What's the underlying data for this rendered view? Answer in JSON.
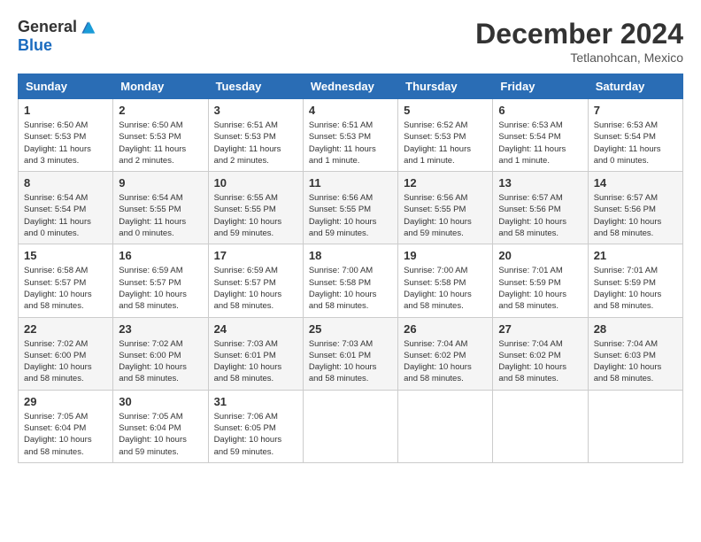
{
  "header": {
    "logo_general": "General",
    "logo_blue": "Blue",
    "title": "December 2024",
    "location": "Tetlanohcan, Mexico"
  },
  "weekdays": [
    "Sunday",
    "Monday",
    "Tuesday",
    "Wednesday",
    "Thursday",
    "Friday",
    "Saturday"
  ],
  "weeks": [
    [
      {
        "day": "1",
        "info": "Sunrise: 6:50 AM\nSunset: 5:53 PM\nDaylight: 11 hours\nand 3 minutes."
      },
      {
        "day": "2",
        "info": "Sunrise: 6:50 AM\nSunset: 5:53 PM\nDaylight: 11 hours\nand 2 minutes."
      },
      {
        "day": "3",
        "info": "Sunrise: 6:51 AM\nSunset: 5:53 PM\nDaylight: 11 hours\nand 2 minutes."
      },
      {
        "day": "4",
        "info": "Sunrise: 6:51 AM\nSunset: 5:53 PM\nDaylight: 11 hours\nand 1 minute."
      },
      {
        "day": "5",
        "info": "Sunrise: 6:52 AM\nSunset: 5:53 PM\nDaylight: 11 hours\nand 1 minute."
      },
      {
        "day": "6",
        "info": "Sunrise: 6:53 AM\nSunset: 5:54 PM\nDaylight: 11 hours\nand 1 minute."
      },
      {
        "day": "7",
        "info": "Sunrise: 6:53 AM\nSunset: 5:54 PM\nDaylight: 11 hours\nand 0 minutes."
      }
    ],
    [
      {
        "day": "8",
        "info": "Sunrise: 6:54 AM\nSunset: 5:54 PM\nDaylight: 11 hours\nand 0 minutes."
      },
      {
        "day": "9",
        "info": "Sunrise: 6:54 AM\nSunset: 5:55 PM\nDaylight: 11 hours\nand 0 minutes."
      },
      {
        "day": "10",
        "info": "Sunrise: 6:55 AM\nSunset: 5:55 PM\nDaylight: 10 hours\nand 59 minutes."
      },
      {
        "day": "11",
        "info": "Sunrise: 6:56 AM\nSunset: 5:55 PM\nDaylight: 10 hours\nand 59 minutes."
      },
      {
        "day": "12",
        "info": "Sunrise: 6:56 AM\nSunset: 5:55 PM\nDaylight: 10 hours\nand 59 minutes."
      },
      {
        "day": "13",
        "info": "Sunrise: 6:57 AM\nSunset: 5:56 PM\nDaylight: 10 hours\nand 58 minutes."
      },
      {
        "day": "14",
        "info": "Sunrise: 6:57 AM\nSunset: 5:56 PM\nDaylight: 10 hours\nand 58 minutes."
      }
    ],
    [
      {
        "day": "15",
        "info": "Sunrise: 6:58 AM\nSunset: 5:57 PM\nDaylight: 10 hours\nand 58 minutes."
      },
      {
        "day": "16",
        "info": "Sunrise: 6:59 AM\nSunset: 5:57 PM\nDaylight: 10 hours\nand 58 minutes."
      },
      {
        "day": "17",
        "info": "Sunrise: 6:59 AM\nSunset: 5:57 PM\nDaylight: 10 hours\nand 58 minutes."
      },
      {
        "day": "18",
        "info": "Sunrise: 7:00 AM\nSunset: 5:58 PM\nDaylight: 10 hours\nand 58 minutes."
      },
      {
        "day": "19",
        "info": "Sunrise: 7:00 AM\nSunset: 5:58 PM\nDaylight: 10 hours\nand 58 minutes."
      },
      {
        "day": "20",
        "info": "Sunrise: 7:01 AM\nSunset: 5:59 PM\nDaylight: 10 hours\nand 58 minutes."
      },
      {
        "day": "21",
        "info": "Sunrise: 7:01 AM\nSunset: 5:59 PM\nDaylight: 10 hours\nand 58 minutes."
      }
    ],
    [
      {
        "day": "22",
        "info": "Sunrise: 7:02 AM\nSunset: 6:00 PM\nDaylight: 10 hours\nand 58 minutes."
      },
      {
        "day": "23",
        "info": "Sunrise: 7:02 AM\nSunset: 6:00 PM\nDaylight: 10 hours\nand 58 minutes."
      },
      {
        "day": "24",
        "info": "Sunrise: 7:03 AM\nSunset: 6:01 PM\nDaylight: 10 hours\nand 58 minutes."
      },
      {
        "day": "25",
        "info": "Sunrise: 7:03 AM\nSunset: 6:01 PM\nDaylight: 10 hours\nand 58 minutes."
      },
      {
        "day": "26",
        "info": "Sunrise: 7:04 AM\nSunset: 6:02 PM\nDaylight: 10 hours\nand 58 minutes."
      },
      {
        "day": "27",
        "info": "Sunrise: 7:04 AM\nSunset: 6:02 PM\nDaylight: 10 hours\nand 58 minutes."
      },
      {
        "day": "28",
        "info": "Sunrise: 7:04 AM\nSunset: 6:03 PM\nDaylight: 10 hours\nand 58 minutes."
      }
    ],
    [
      {
        "day": "29",
        "info": "Sunrise: 7:05 AM\nSunset: 6:04 PM\nDaylight: 10 hours\nand 58 minutes."
      },
      {
        "day": "30",
        "info": "Sunrise: 7:05 AM\nSunset: 6:04 PM\nDaylight: 10 hours\nand 59 minutes."
      },
      {
        "day": "31",
        "info": "Sunrise: 7:06 AM\nSunset: 6:05 PM\nDaylight: 10 hours\nand 59 minutes."
      },
      {
        "day": "",
        "info": ""
      },
      {
        "day": "",
        "info": ""
      },
      {
        "day": "",
        "info": ""
      },
      {
        "day": "",
        "info": ""
      }
    ]
  ]
}
